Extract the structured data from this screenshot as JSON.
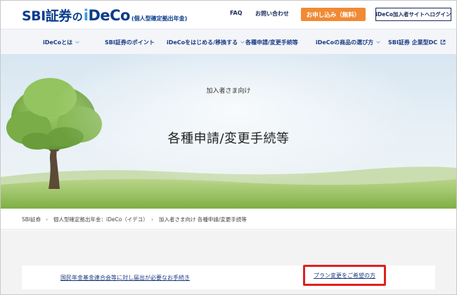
{
  "header": {
    "logo": {
      "sbi": "SBI証券",
      "no": "の",
      "ideco_i": "i",
      "ideco_rest": "DeCo",
      "sub": "(個人型確定拠出年金)"
    },
    "faq": "FAQ",
    "contact": "お問い合わせ",
    "apply_button": "お申し込み（無料）",
    "login_button": "iDeCo加入者サイトへログイン"
  },
  "nav": {
    "items": [
      {
        "label": "iDeCoとは"
      },
      {
        "label": "SBI証券のポイント"
      },
      {
        "label": "iDeCoをはじめる/移換する"
      },
      {
        "label": "各種申請/変更手続等"
      },
      {
        "label": "iDeCoの商品の選び方"
      },
      {
        "label": "SBI証券 企業型DC"
      }
    ]
  },
  "hero": {
    "subtitle": "加入者さま向け",
    "title": "各種申請/変更手続等"
  },
  "breadcrumb": {
    "items": [
      {
        "label": "SBI証券"
      },
      {
        "label": "個人型確定拠出年金：iDeCo（イデコ）"
      },
      {
        "label": "加入者さま向け 各種申請/変更手続等"
      }
    ],
    "separator": "›"
  },
  "links": {
    "left": "国民年金基金連合会等に対し届出が必要なお手続き",
    "right": "プラン変更をご希望の方"
  },
  "colors": {
    "brand_navy": "#0a3c8c",
    "brand_light_blue": "#3aa0dc",
    "apply_orange": "#f08a34",
    "highlight_red": "#e02020"
  }
}
